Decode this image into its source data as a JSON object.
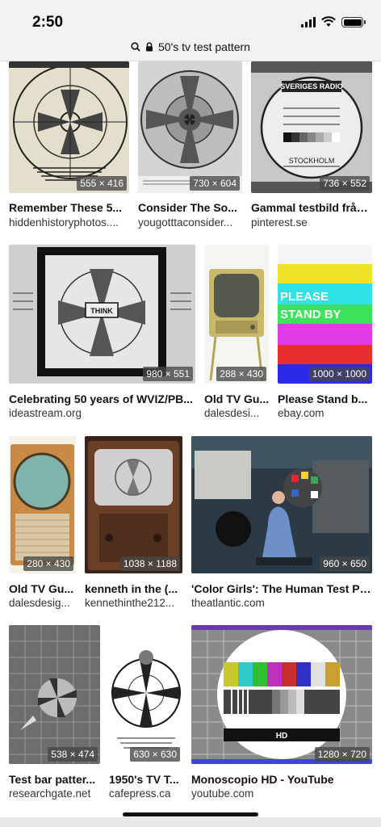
{
  "status": {
    "time": "2:50"
  },
  "search": {
    "query": "50's tv test pattern"
  },
  "results": [
    {
      "title": "Remember These 5...",
      "source": "hiddenhistoryphotos....",
      "dims": "555 × 416"
    },
    {
      "title": "Consider The So...",
      "source": "yougotttaconsider...",
      "dims": "730 × 604"
    },
    {
      "title": "Gammal testbild från...",
      "source": "pinterest.se",
      "dims": "736 × 552"
    },
    {
      "title": "Celebrating 50 years of WVIZ/PB...",
      "source": "ideastream.org",
      "dims": "980 × 551"
    },
    {
      "title": "Old TV Gu...",
      "source": "dalesdesi...",
      "dims": "288 × 430"
    },
    {
      "title": "Please Stand b...",
      "source": "ebay.com",
      "dims": "1000 × 1000"
    },
    {
      "title": "Old TV Gu...",
      "source": "dalesdesig...",
      "dims": "280 × 430"
    },
    {
      "title": "kenneth in the (...",
      "source": "kennethinthe212...",
      "dims": "1038 × 1188"
    },
    {
      "title": "'Color Girls': The Human Test Pa...",
      "source": "theatlantic.com",
      "dims": "960 × 650"
    },
    {
      "title": "Test bar patter...",
      "source": "researchgate.net",
      "dims": "538 × 474"
    },
    {
      "title": "1950's TV T...",
      "source": "cafepress.ca",
      "dims": "630 × 630"
    },
    {
      "title": "Monoscopio HD - YouTube",
      "source": "youtube.com",
      "dims": "1280 × 720"
    }
  ],
  "thumb_text": {
    "think": "THINK",
    "please": "PLEASE",
    "stand_by": "STAND BY",
    "sveriges": "SVERIGES RADIO",
    "stockholm": "STOCKHOLM",
    "hd": "HD"
  }
}
